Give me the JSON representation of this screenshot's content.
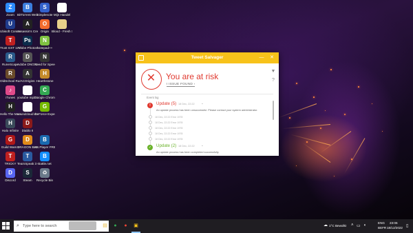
{
  "desktop": {
    "icons": [
      {
        "label": "Zoom",
        "glyph": "Z",
        "color": "#2d8cff"
      },
      {
        "label": "BitTorrent Web",
        "glyph": "B",
        "color": "#3b7ddd"
      },
      {
        "label": "Simplenote",
        "glyph": "S",
        "color": "#3361cc"
      },
      {
        "label": "Mijn Handel",
        "glyph": "",
        "color": "#ffffff"
      },
      {
        "label": "Ubisoft Connect",
        "glyph": "U",
        "color": "#1f3b8c"
      },
      {
        "label": "Assassin's Creed V...",
        "glyph": "A",
        "color": "#222222"
      },
      {
        "label": "Origin",
        "glyph": "O",
        "color": "#f56c2d"
      },
      {
        "label": "Blood - Fresh Supply",
        "glyph": "",
        "color": "#e8d08a"
      },
      {
        "label": "Trust GXT 177",
        "glyph": "T",
        "color": "#c02020"
      },
      {
        "label": "Adobe Photosho...",
        "glyph": "Ps",
        "color": "#0b2c4a"
      },
      {
        "label": "Notepad++",
        "glyph": "N",
        "color": "#7fc241"
      },
      {
        "label": "RuneScape",
        "glyph": "R",
        "color": "#2a5a8a"
      },
      {
        "label": "Adobe DNG Converter",
        "glyph": "D",
        "color": "#555555"
      },
      {
        "label": "Need for Speed Und...",
        "glyph": "N",
        "color": "#333333"
      },
      {
        "label": "OldSchool RuneScape",
        "glyph": "R",
        "color": "#6a4b2a"
      },
      {
        "label": "ACOrigins",
        "glyph": "A",
        "color": "#333333"
      },
      {
        "label": "Hearthstone",
        "glyph": "H",
        "color": "#c48a2a"
      },
      {
        "label": "iTunes",
        "glyph": "♪",
        "color": "#e04a8a"
      },
      {
        "label": "youtube mp3 converter",
        "glyph": "",
        "color": "#ffffff"
      },
      {
        "label": "Google Chrome",
        "glyph": "C",
        "color": "#34a853"
      },
      {
        "label": "Hello The Master Chi...",
        "glyph": "H",
        "color": "#222222"
      },
      {
        "label": "soundcloud downloader",
        "glyph": "",
        "color": "#ffffff"
      },
      {
        "label": "GeForce Experience",
        "glyph": "G",
        "color": "#76b900"
      },
      {
        "label": "Halo Infinite",
        "glyph": "H",
        "color": "#3a4a5a"
      },
      {
        "label": "Diablo II",
        "glyph": "D",
        "color": "#8a1a1a"
      },
      {
        "label": "Guild Wars 2",
        "glyph": "G",
        "color": "#b01818"
      },
      {
        "label": "DRAGON BALL XENO...",
        "glyph": "D",
        "color": "#e08a1a"
      },
      {
        "label": "BS.Player FREE",
        "glyph": "B",
        "color": "#1a6ab0"
      },
      {
        "label": "TRICKY",
        "glyph": "T",
        "color": "#c02020"
      },
      {
        "label": "TeamSpeak 3 Client",
        "glyph": "T",
        "color": "#2a5aa0"
      },
      {
        "label": "Battle.net",
        "glyph": "B",
        "color": "#148eff"
      },
      {
        "label": "Discord",
        "glyph": "D",
        "color": "#5865f2"
      },
      {
        "label": "Steam",
        "glyph": "S",
        "color": "#1b2838"
      },
      {
        "label": "Recycle Bin",
        "glyph": "♻",
        "color": "#6a7a8a"
      }
    ]
  },
  "window": {
    "title": "Tweet Salvager",
    "minimize_glyph": "—",
    "close_glyph": "✕",
    "risk_title": "You are at risk",
    "risk_link": "I ISSUE FOUND",
    "risk_link_arrow": "›",
    "event_log_label": "Event log",
    "accent_color": "#f7c21a",
    "danger_color": "#e0392f",
    "success_color": "#6ab22a",
    "entries": [
      {
        "title": "Update (5)",
        "date": "18 Dec, 22:22",
        "caret": "⌄",
        "badge": "!",
        "description": "An update process has been unsuccessful. Please contact your system administrator.",
        "sub": [
          "18 Dec, 22:22   Error 1978",
          "18 Dec, 22:22   Error 1978",
          "18 Dec, 22:22   Error 1978",
          "18 Dec, 22:22   Error 1978",
          "18 Dec, 22:22   Error 1978"
        ]
      },
      {
        "title": "Update (2)",
        "date": "18 Dec, 22:22",
        "caret": "⌄",
        "badge": "✓",
        "description": "An update process has been completed successfully."
      }
    ]
  },
  "taskbar": {
    "search_placeholder": "Type here to search",
    "weather": "1°C  Bewolkt",
    "lang": "ENG",
    "region": "BEFR",
    "time": "23:06",
    "date": "18/12/2022",
    "apps": [
      {
        "name": "explorer",
        "glyph": "▤",
        "color": "#e8b83a"
      },
      {
        "name": "chrome",
        "glyph": "●",
        "color": "#34a853"
      },
      {
        "name": "chrome-2",
        "glyph": "●",
        "color": "#ea4335"
      },
      {
        "name": "tweet-salvager",
        "glyph": "▣",
        "color": "#f7c21a"
      }
    ]
  }
}
